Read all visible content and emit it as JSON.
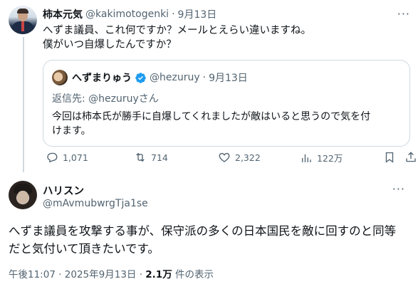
{
  "colors": {
    "text": "#0f1419",
    "muted": "#536471",
    "border": "#cfd9de",
    "verified": "#1d9bf0"
  },
  "tweet1": {
    "name": "柿本元気",
    "handle": "@kakimotogenki",
    "separator": "·",
    "date": "9月13日",
    "more": "···",
    "text_line1": "へずま議員、これ何ですか？メールとえらい違いますね。",
    "text_line2": "僕がいつ自爆したんですか？",
    "quote": {
      "name": "へずまりゅう",
      "handle": "@hezuruy",
      "separator": "·",
      "date": "9月13日",
      "reply_to": "返信先: @hezuruyさん",
      "text_line1": "今回は柿本氏が勝手に自爆してくれましたが敵はいると思うので気を付",
      "text_line2": "けます。"
    },
    "actions": {
      "replies": "1,071",
      "reposts": "714",
      "likes": "2,322",
      "views": "122万"
    }
  },
  "tweet2": {
    "name": "ハリスン",
    "handle": "@mAvmubwrgTja1se",
    "more": "···",
    "text_line1": "へずま議員を攻撃する事が、保守派の多くの日本国民を敵に回すのと同等",
    "text_line2": "だと気付いて頂きたいです。",
    "time": "午後11:07 · 2025年9月13日 · ",
    "views_count": "2.1万",
    "views_label": " 件の表示"
  }
}
